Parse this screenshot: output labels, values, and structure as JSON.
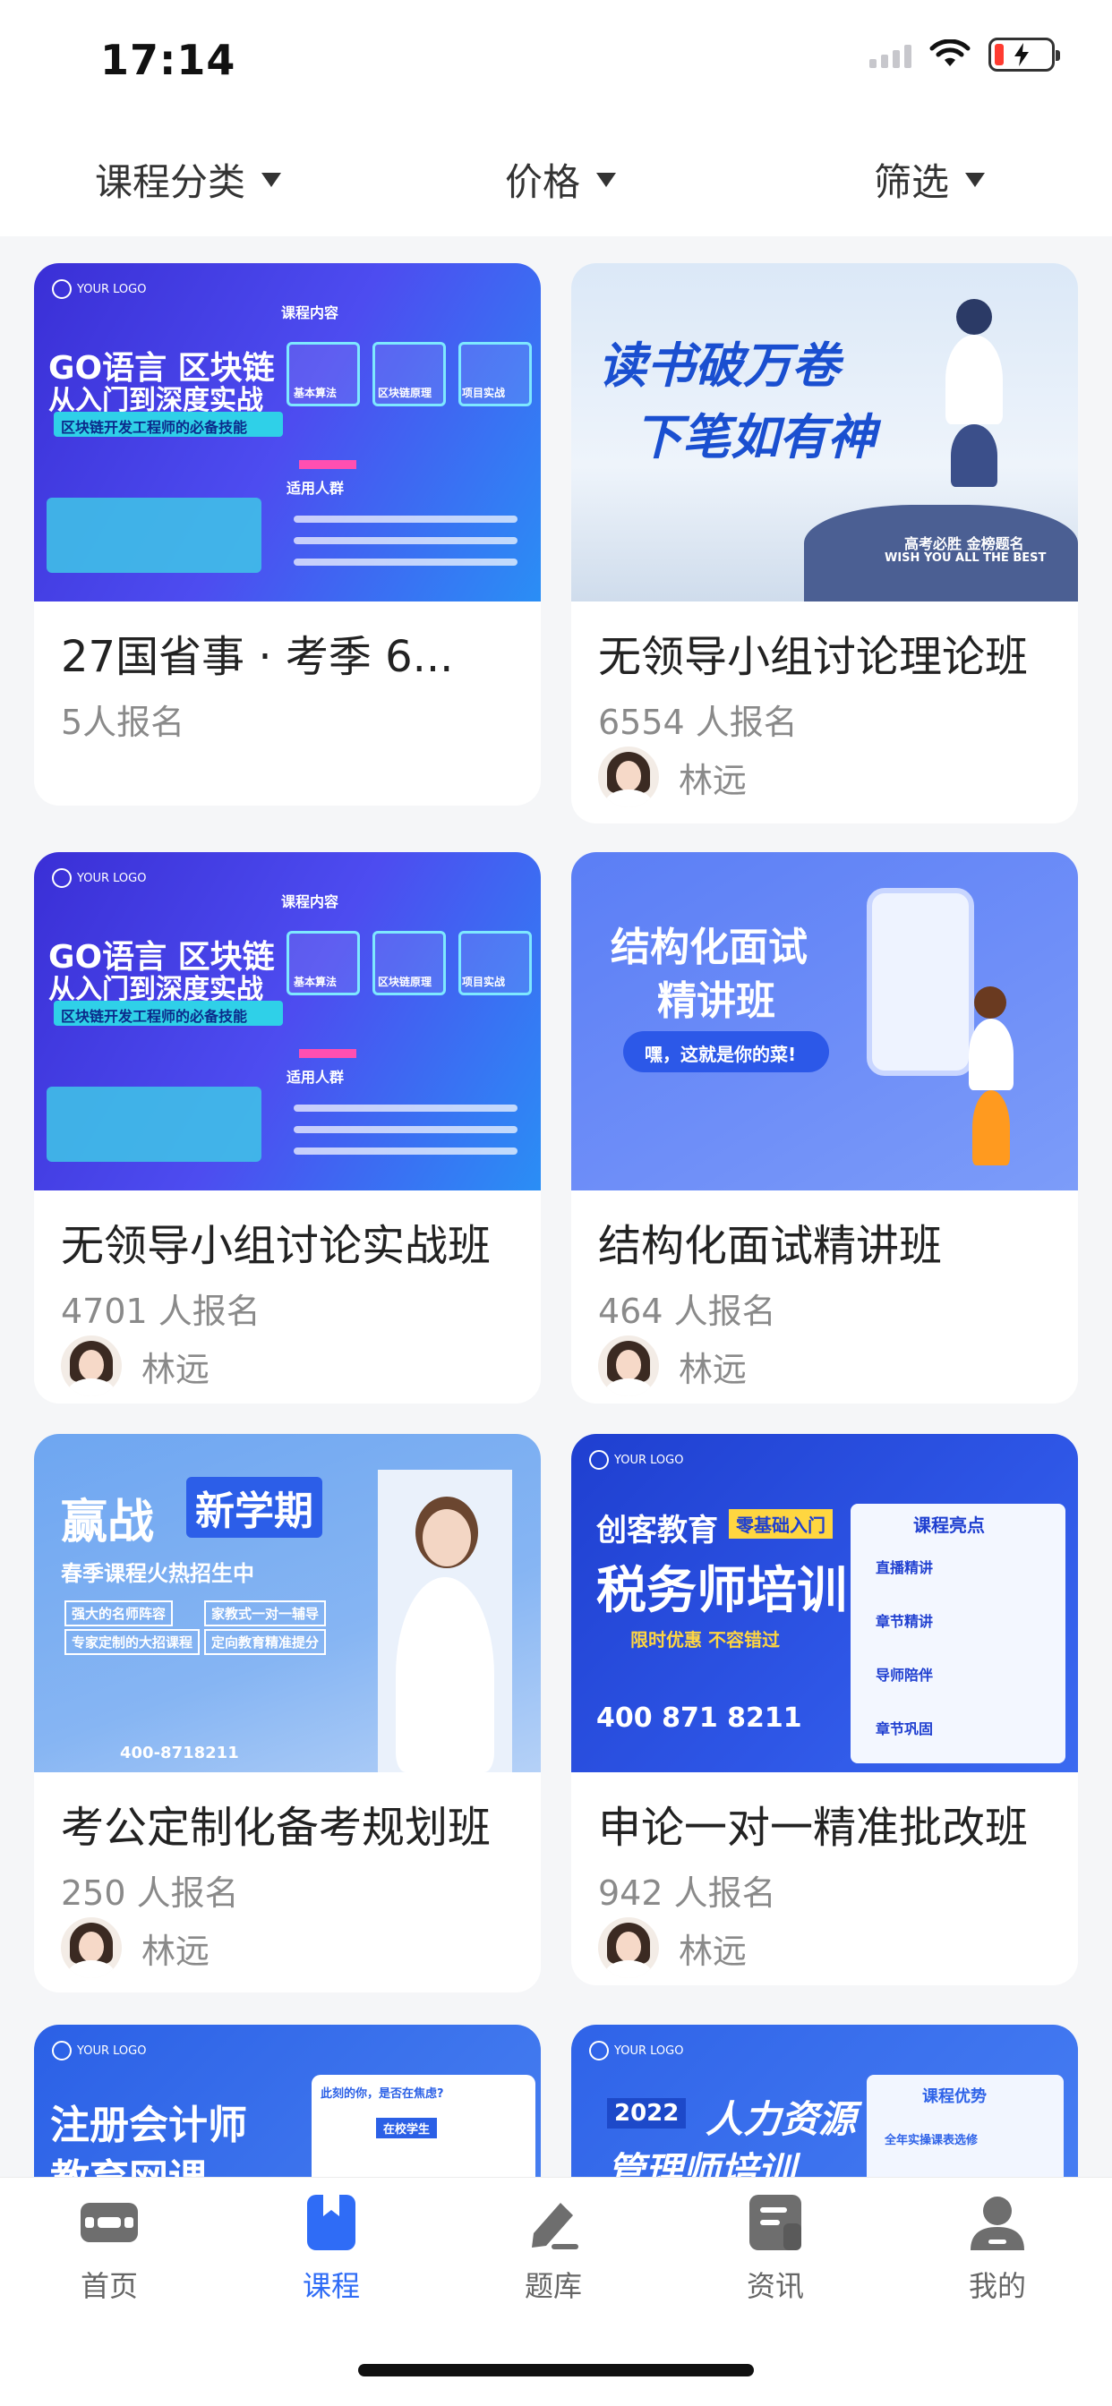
{
  "status_bar": {
    "time": "17:14"
  },
  "filters": [
    {
      "label": "课程分类"
    },
    {
      "label": "价格"
    },
    {
      "label": "筛选"
    }
  ],
  "courses": [
    {
      "title": "27国省事 · 考季 6...",
      "count": "5人报名",
      "teacher": "",
      "cover_text": [
        "GO语言 区块链",
        "从入门到深度实战",
        "区块链开发工程师的必备技能",
        "课程内容",
        "适用人群",
        "基本算法",
        "区块链原理",
        "项目实战"
      ]
    },
    {
      "title": "无领导小组讨论理论班",
      "count": "6554 人报名",
      "teacher": "林远",
      "cover_text": [
        "读书破万卷",
        "下笔如有神",
        "高考必胜 金榜题名",
        "WISH YOU ALL THE BEST"
      ]
    },
    {
      "title": "无领导小组讨论实战班",
      "count": "4701 人报名",
      "teacher": "林远",
      "cover_text": [
        "GO语言 区块链",
        "从入门到深度实战",
        "区块链开发工程师的必备技能",
        "课程内容",
        "适用人群",
        "基本算法",
        "区块链原理",
        "项目实战"
      ]
    },
    {
      "title": "结构化面试精讲班",
      "count": "464 人报名",
      "teacher": "林远",
      "cover_text": [
        "结构化面试",
        "精讲班",
        "嘿，这就是你的菜!"
      ]
    },
    {
      "title": "考公定制化备考规划班",
      "count": "250 人报名",
      "teacher": "林远",
      "cover_text": [
        "赢战",
        "新学期",
        "春季课程火热招生中",
        "强大的名师阵容",
        "家教式一对一辅导",
        "专家定制的大招课程",
        "定向教育精准提分",
        "400-8718211"
      ]
    },
    {
      "title": "申论一对一精准批改班",
      "count": "942 人报名",
      "teacher": "林远",
      "cover_text": [
        "创客教育",
        "零基础入门",
        "税务师培训",
        "限时优惠 不容错过",
        "课程亮点",
        "直播精讲",
        "章节精讲",
        "导师陪伴",
        "章节巩固",
        "400 871 8211"
      ]
    },
    {
      "title": "",
      "count": "",
      "teacher": "",
      "cover_text": [
        "注册会计师",
        "教育网课",
        "此刻的你，是否在焦虑?",
        "在校学生"
      ]
    },
    {
      "title": "",
      "count": "",
      "teacher": "",
      "cover_text": [
        "2022",
        "人力资源",
        "管理师培训",
        "课程优势",
        "全年实操课表选修"
      ]
    }
  ],
  "tabs": [
    {
      "label": "首页",
      "icon": "home-icon"
    },
    {
      "label": "课程",
      "icon": "course-icon"
    },
    {
      "label": "题库",
      "icon": "question-bank-icon"
    },
    {
      "label": "资讯",
      "icon": "news-icon"
    },
    {
      "label": "我的",
      "icon": "profile-icon"
    }
  ],
  "colors": {
    "accent": "#2f6cf6",
    "muted": "#8a8a8a",
    "title": "#222222"
  }
}
